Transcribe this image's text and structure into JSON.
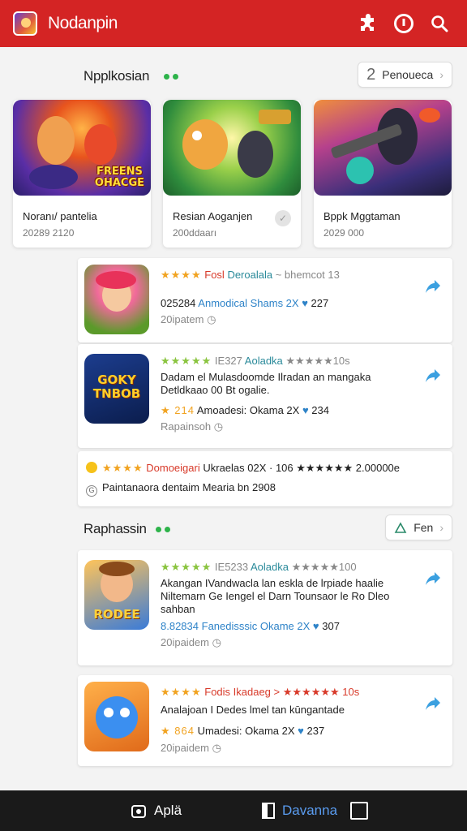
{
  "app": {
    "title": "Nodanpin"
  },
  "header": {
    "icons": [
      "puzzle-icon",
      "record-icon",
      "search-icon"
    ]
  },
  "section1": {
    "title": "Npplkosian",
    "button_lead": "2",
    "button_label": "Penoueca"
  },
  "featured": [
    {
      "title": "Noranı/ pantelia",
      "subtitle": "20289 2120",
      "banner_text": "FREENS\nOHACGE"
    },
    {
      "title": "Resian Aoganjen",
      "subtitle": "200ddaarı"
    },
    {
      "title": "Bppk Mggtaman",
      "subtitle": "2029 000"
    }
  ],
  "list1": [
    {
      "rating_stars": "★★★★",
      "line1_a": "Fosl",
      "line1_b": "Deroalala",
      "line1_c": "~ bhemcot 13",
      "line2_a": "025284",
      "line2_b": "Anmodical Shams 2X",
      "line2_c": "227",
      "line3": "20ipatem"
    },
    {
      "rating_stars": "★★★★★",
      "line1_a": "IE327",
      "line1_b": "Aoladka",
      "line1_c": "★★★★★10s",
      "desc1": "Dadam el Mulasdoomde Ilradan an mangaka",
      "desc2": "Detldkaao 00 Bt ogalie.",
      "line2_a": "★ 214",
      "line2_b": "Amoadesi: Okama 2X",
      "line2_c": "234",
      "line3": "Rapainsoh",
      "icon_text": "GOKY\nTNBOB"
    }
  ],
  "promo": {
    "line1_a": "★★★★",
    "line1_b": "Domoeigari",
    "line1_c": "Ukraelas 02X · 106 ★★★★★★ 2.00000e",
    "line2": "Paintanaora dentaim Mearia bn 2908"
  },
  "section2": {
    "title": "Raphassin",
    "button_label": "Fen"
  },
  "list2": [
    {
      "rating_stars": "★★★★★",
      "line1_a": "IE5233",
      "line1_b": "Aoladka",
      "line1_c": "★★★★★100",
      "desc1": "Akangan IVandwacla lan eskla de lrpiade haalie",
      "desc2": "Niltemarn Ge Iengel el Darn Tounsaor le Ro Dleo",
      "desc3": "sahban",
      "line2_a": "8.82834",
      "line2_b": "Fanedisssic Okame 2X",
      "line2_c": "307",
      "line3": "20ipaidem",
      "icon_text": "RODEE"
    },
    {
      "rating_stars": "★★★★",
      "line1_a": "Fodis Ikadaeg",
      "line1_b": "> ★★★★★★ 10s",
      "desc1": "Analajoan I Dedes lmel tan kūngantade",
      "line2_a": "★ 864",
      "line2_b": "Umadesi: Okama 2X",
      "line2_c": "237",
      "line3": "20ipaidem"
    }
  ],
  "bottom_nav": [
    {
      "label": "Aplä",
      "icon": "home-icon"
    },
    {
      "label": "Davanna",
      "icon": "document-icon"
    },
    {
      "label": "",
      "icon": "square-icon"
    }
  ],
  "colors": {
    "header": "#d42424",
    "accent_green": "#2db34a",
    "star": "#f1a321",
    "link_blue": "#2e83c8"
  }
}
